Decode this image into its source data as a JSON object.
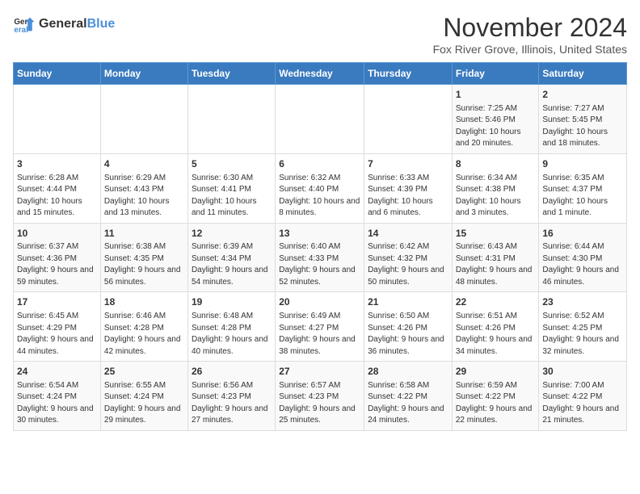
{
  "logo": {
    "general": "General",
    "blue": "Blue"
  },
  "title": "November 2024",
  "subtitle": "Fox River Grove, Illinois, United States",
  "days_header": [
    "Sunday",
    "Monday",
    "Tuesday",
    "Wednesday",
    "Thursday",
    "Friday",
    "Saturday"
  ],
  "weeks": [
    [
      {
        "day": "",
        "info": ""
      },
      {
        "day": "",
        "info": ""
      },
      {
        "day": "",
        "info": ""
      },
      {
        "day": "",
        "info": ""
      },
      {
        "day": "",
        "info": ""
      },
      {
        "day": "1",
        "info": "Sunrise: 7:25 AM\nSunset: 5:46 PM\nDaylight: 10 hours and 20 minutes."
      },
      {
        "day": "2",
        "info": "Sunrise: 7:27 AM\nSunset: 5:45 PM\nDaylight: 10 hours and 18 minutes."
      }
    ],
    [
      {
        "day": "3",
        "info": "Sunrise: 6:28 AM\nSunset: 4:44 PM\nDaylight: 10 hours and 15 minutes."
      },
      {
        "day": "4",
        "info": "Sunrise: 6:29 AM\nSunset: 4:43 PM\nDaylight: 10 hours and 13 minutes."
      },
      {
        "day": "5",
        "info": "Sunrise: 6:30 AM\nSunset: 4:41 PM\nDaylight: 10 hours and 11 minutes."
      },
      {
        "day": "6",
        "info": "Sunrise: 6:32 AM\nSunset: 4:40 PM\nDaylight: 10 hours and 8 minutes."
      },
      {
        "day": "7",
        "info": "Sunrise: 6:33 AM\nSunset: 4:39 PM\nDaylight: 10 hours and 6 minutes."
      },
      {
        "day": "8",
        "info": "Sunrise: 6:34 AM\nSunset: 4:38 PM\nDaylight: 10 hours and 3 minutes."
      },
      {
        "day": "9",
        "info": "Sunrise: 6:35 AM\nSunset: 4:37 PM\nDaylight: 10 hours and 1 minute."
      }
    ],
    [
      {
        "day": "10",
        "info": "Sunrise: 6:37 AM\nSunset: 4:36 PM\nDaylight: 9 hours and 59 minutes."
      },
      {
        "day": "11",
        "info": "Sunrise: 6:38 AM\nSunset: 4:35 PM\nDaylight: 9 hours and 56 minutes."
      },
      {
        "day": "12",
        "info": "Sunrise: 6:39 AM\nSunset: 4:34 PM\nDaylight: 9 hours and 54 minutes."
      },
      {
        "day": "13",
        "info": "Sunrise: 6:40 AM\nSunset: 4:33 PM\nDaylight: 9 hours and 52 minutes."
      },
      {
        "day": "14",
        "info": "Sunrise: 6:42 AM\nSunset: 4:32 PM\nDaylight: 9 hours and 50 minutes."
      },
      {
        "day": "15",
        "info": "Sunrise: 6:43 AM\nSunset: 4:31 PM\nDaylight: 9 hours and 48 minutes."
      },
      {
        "day": "16",
        "info": "Sunrise: 6:44 AM\nSunset: 4:30 PM\nDaylight: 9 hours and 46 minutes."
      }
    ],
    [
      {
        "day": "17",
        "info": "Sunrise: 6:45 AM\nSunset: 4:29 PM\nDaylight: 9 hours and 44 minutes."
      },
      {
        "day": "18",
        "info": "Sunrise: 6:46 AM\nSunset: 4:28 PM\nDaylight: 9 hours and 42 minutes."
      },
      {
        "day": "19",
        "info": "Sunrise: 6:48 AM\nSunset: 4:28 PM\nDaylight: 9 hours and 40 minutes."
      },
      {
        "day": "20",
        "info": "Sunrise: 6:49 AM\nSunset: 4:27 PM\nDaylight: 9 hours and 38 minutes."
      },
      {
        "day": "21",
        "info": "Sunrise: 6:50 AM\nSunset: 4:26 PM\nDaylight: 9 hours and 36 minutes."
      },
      {
        "day": "22",
        "info": "Sunrise: 6:51 AM\nSunset: 4:26 PM\nDaylight: 9 hours and 34 minutes."
      },
      {
        "day": "23",
        "info": "Sunrise: 6:52 AM\nSunset: 4:25 PM\nDaylight: 9 hours and 32 minutes."
      }
    ],
    [
      {
        "day": "24",
        "info": "Sunrise: 6:54 AM\nSunset: 4:24 PM\nDaylight: 9 hours and 30 minutes."
      },
      {
        "day": "25",
        "info": "Sunrise: 6:55 AM\nSunset: 4:24 PM\nDaylight: 9 hours and 29 minutes."
      },
      {
        "day": "26",
        "info": "Sunrise: 6:56 AM\nSunset: 4:23 PM\nDaylight: 9 hours and 27 minutes."
      },
      {
        "day": "27",
        "info": "Sunrise: 6:57 AM\nSunset: 4:23 PM\nDaylight: 9 hours and 25 minutes."
      },
      {
        "day": "28",
        "info": "Sunrise: 6:58 AM\nSunset: 4:22 PM\nDaylight: 9 hours and 24 minutes."
      },
      {
        "day": "29",
        "info": "Sunrise: 6:59 AM\nSunset: 4:22 PM\nDaylight: 9 hours and 22 minutes."
      },
      {
        "day": "30",
        "info": "Sunrise: 7:00 AM\nSunset: 4:22 PM\nDaylight: 9 hours and 21 minutes."
      }
    ]
  ]
}
